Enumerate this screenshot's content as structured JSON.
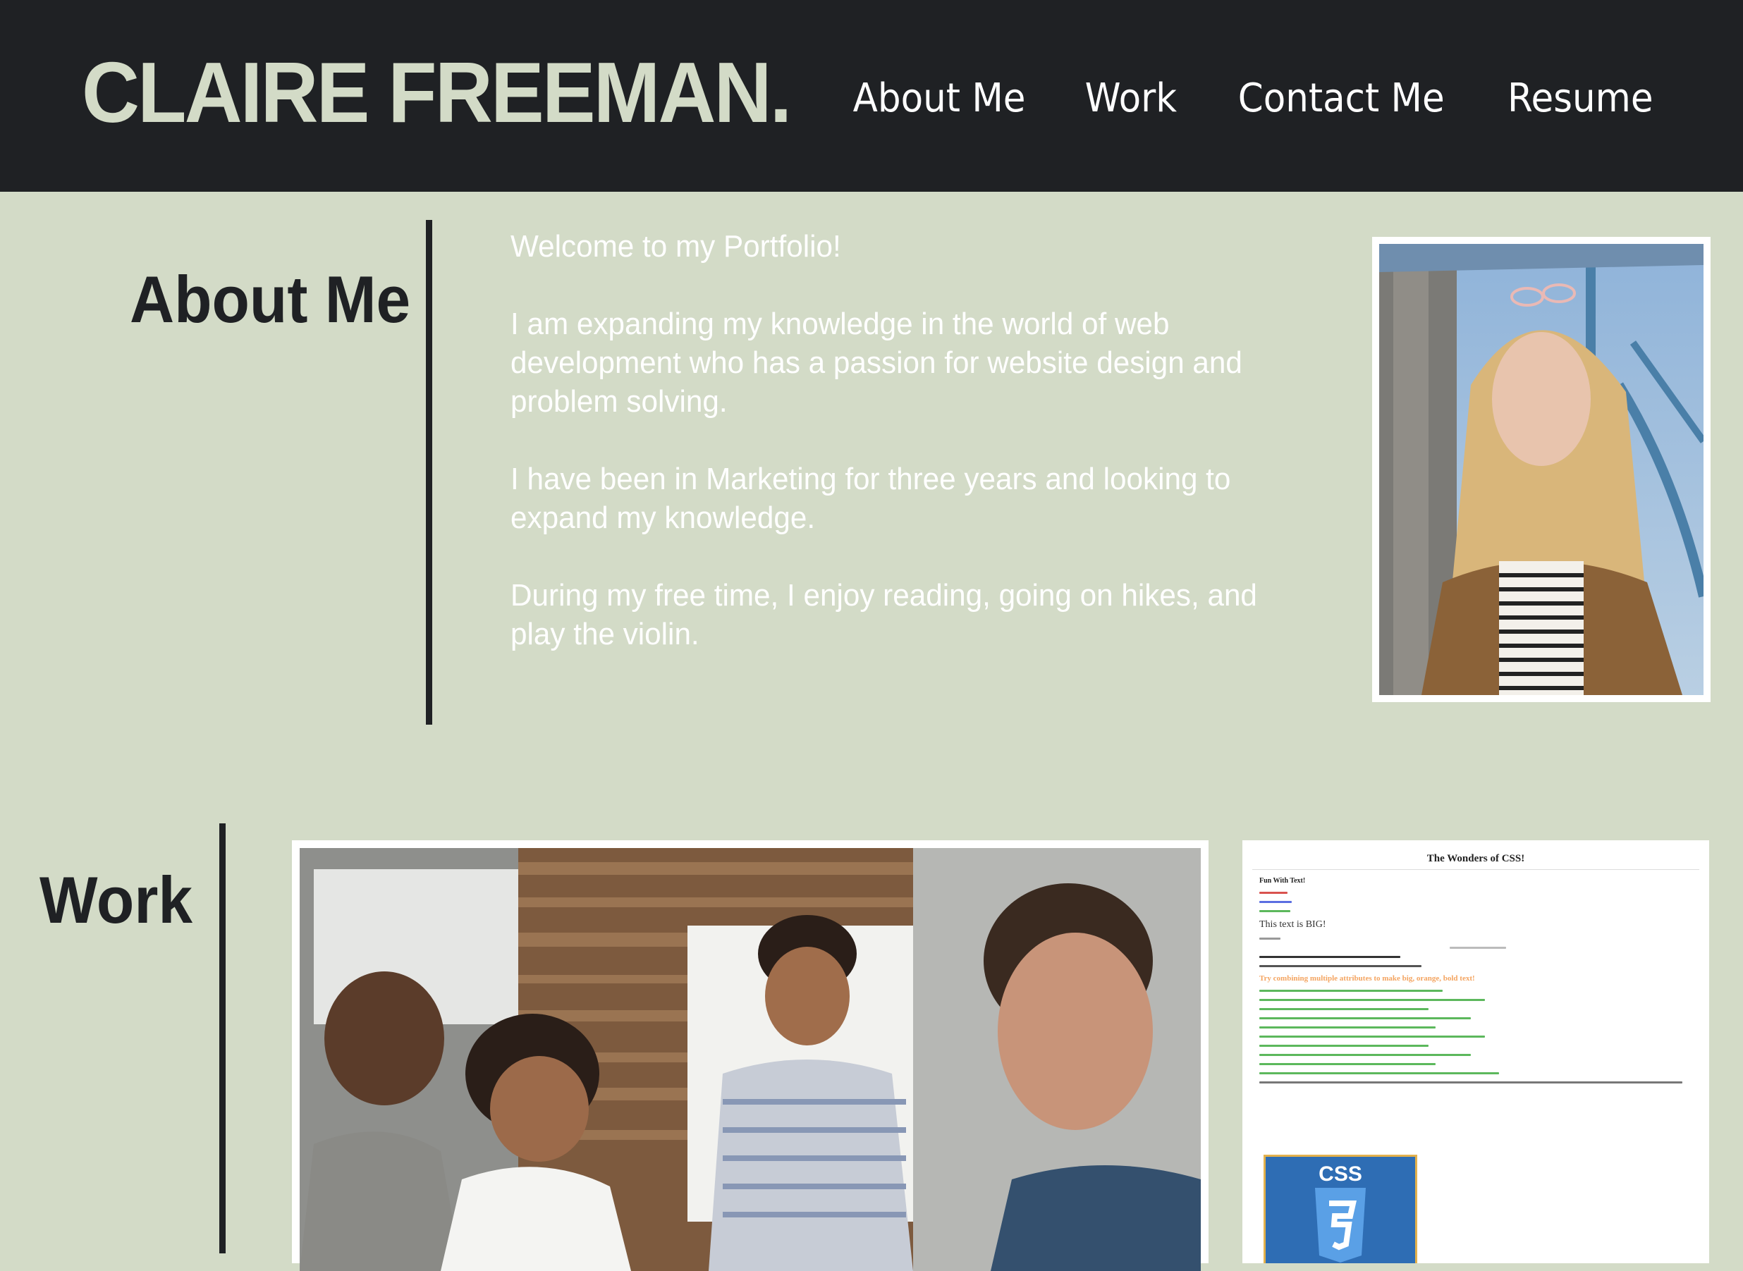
{
  "header": {
    "brand": "CLAIRE FREEMAN.",
    "nav": [
      "About Me",
      "Work",
      "Contact Me",
      "Resume"
    ]
  },
  "about": {
    "heading": "About Me",
    "paragraphs": [
      "Welcome to my Portfolio!",
      "I am expanding my knowledge in the world of web development who has a passion for website design and problem solving.",
      "I have been in Marketing for three years and looking to expand my knowledge.",
      "During my free time, I enjoy reading, going on hikes, and play the violin."
    ]
  },
  "work": {
    "heading": "Work",
    "project_2_page": {
      "title": "The Wonders of CSS!",
      "subtitle": "Fun With Text!",
      "big_text": "This text is BIG!",
      "orange_text": "Try combining multiple attributes to make big, orange, bold text!"
    }
  },
  "colors": {
    "header_bg": "#1f2124",
    "page_bg": "#d3dbc7",
    "accent_text": "#d3dbc7",
    "text_white": "#ffffff"
  }
}
